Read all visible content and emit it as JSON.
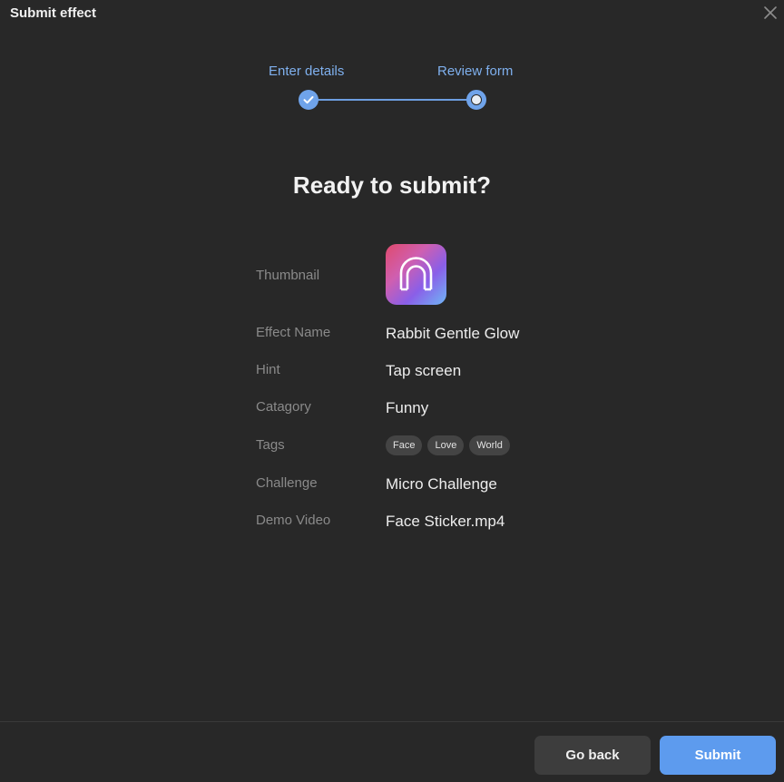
{
  "dialog": {
    "title": "Submit effect",
    "close_icon": "close-icon"
  },
  "stepper": {
    "steps": [
      {
        "label": "Enter details",
        "state": "done"
      },
      {
        "label": "Review form",
        "state": "current"
      }
    ],
    "accent": "#6fa3ea"
  },
  "main": {
    "heading": "Ready to submit?",
    "rows": {
      "thumbnail": {
        "label": "Thumbnail",
        "icon": "arch-icon"
      },
      "effect_name": {
        "label": "Effect Name",
        "value": "Rabbit Gentle Glow"
      },
      "hint": {
        "label": "Hint",
        "value": "Tap screen"
      },
      "category": {
        "label": "Catagory",
        "value": "Funny"
      },
      "tags": {
        "label": "Tags",
        "values": [
          "Face",
          "Love",
          "World"
        ]
      },
      "challenge": {
        "label": "Challenge",
        "value": "Micro Challenge"
      },
      "demo_video": {
        "label": "Demo Video",
        "value": "Face Sticker.mp4"
      }
    }
  },
  "footer": {
    "back_label": "Go back",
    "submit_label": "Submit",
    "submit_color": "#5d9bee"
  }
}
